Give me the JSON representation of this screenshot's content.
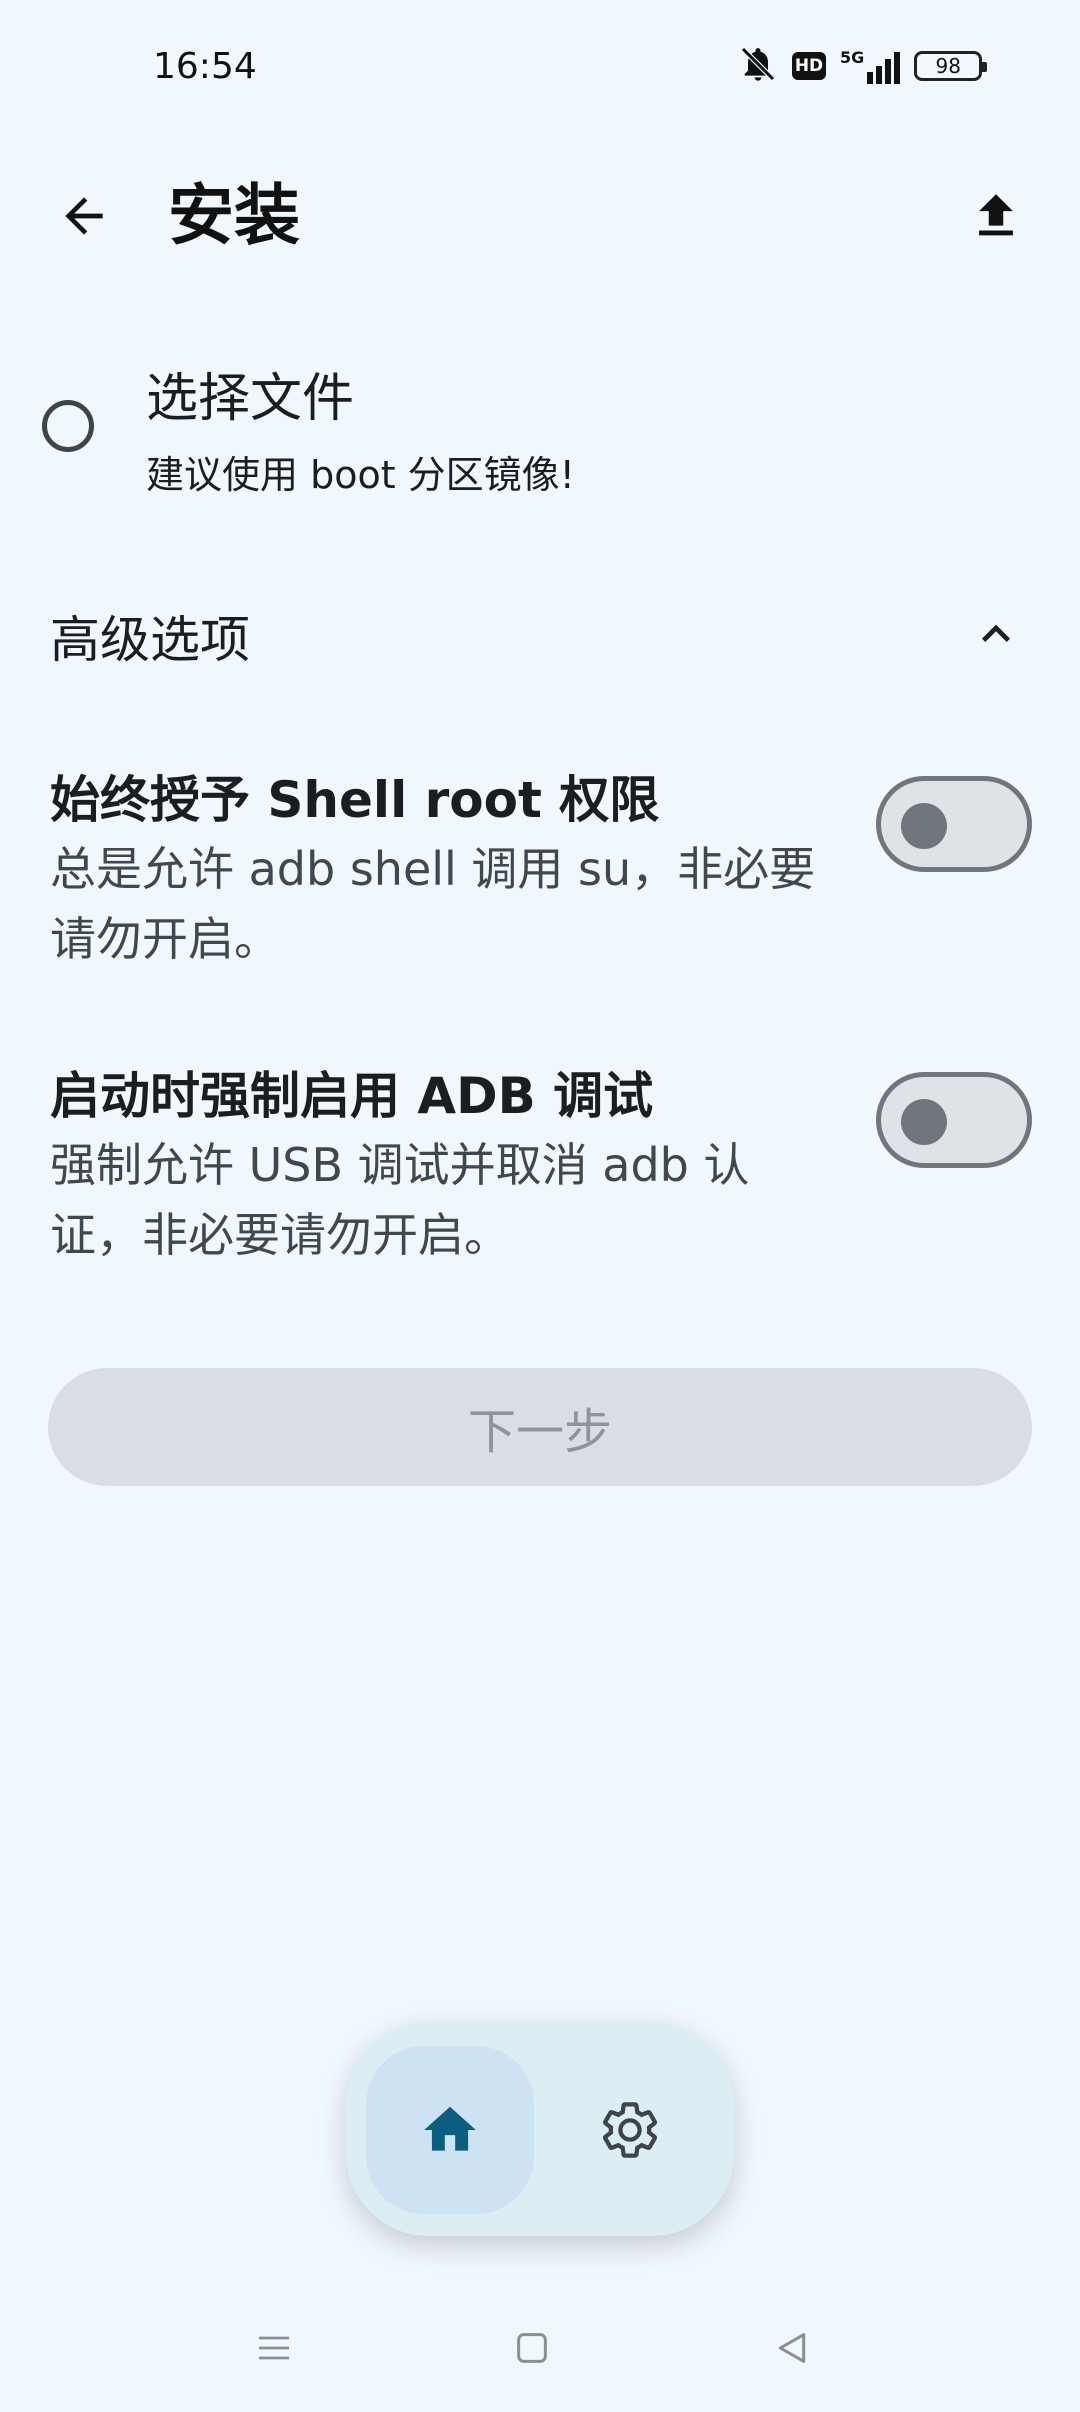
{
  "status_bar": {
    "time": "16:54",
    "icons": [
      "bell-muted-icon",
      "hd-icon",
      "signal-5g-icon",
      "battery-icon"
    ],
    "hd_label": "HD",
    "network_label": "5G",
    "battery_level": "98"
  },
  "app_bar": {
    "title": "安装",
    "back_icon": "arrow-back-icon",
    "action_icon": "upload-icon"
  },
  "select_file": {
    "title": "选择文件",
    "subtitle": "建议使用 boot 分区镜像!",
    "selected": false
  },
  "advanced": {
    "title": "高级选项",
    "expanded": true,
    "options": [
      {
        "title": "始终授予 Shell root 权限",
        "description": "总是允许 adb shell 调用 su，非必要请勿开启。",
        "enabled": false
      },
      {
        "title": "启动时强制启用 ADB 调试",
        "description": "强制允许 USB 调试并取消 adb 认证，非必要请勿开启。",
        "enabled": false
      }
    ]
  },
  "next_button": {
    "label": "下一步",
    "enabled": false
  },
  "bottom_nav": {
    "items": [
      {
        "icon": "home-icon",
        "selected": true
      },
      {
        "icon": "gear-icon",
        "selected": false
      }
    ]
  },
  "colors": {
    "background": "#F1F8FD",
    "accent": "#0B5E80",
    "nav_selected": "#CDE2F2",
    "switch_outline": "#6F767C"
  }
}
